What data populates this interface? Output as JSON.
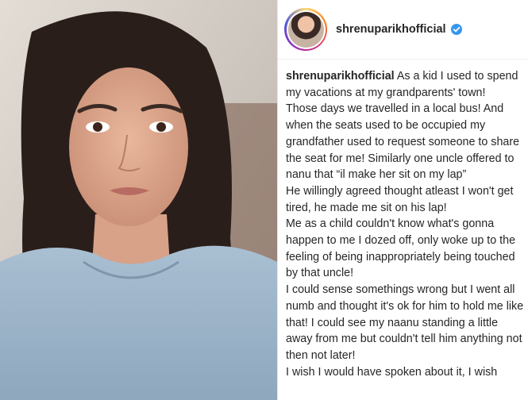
{
  "post": {
    "username": "shrenuparikhofficial",
    "verified": true,
    "caption_user": "shrenuparikhofficial",
    "caption_first": "As a kid I used to spend my vacations at my grandparents' town!",
    "caption_paragraphs": [
      "Those days we travelled in a local bus! And when the seats used to be occupied my grandfather used to request someone to share the seat for me! Similarly one uncle offered to nanu that “il make her sit on my lap”",
      "He willingly agreed thought atleast I won't get tired, he made me sit on his lap!",
      "Me as a child couldn't know what's gonna happen to me I dozed off, only woke up to the feeling of being inappropriately being touched by that uncle!",
      "I could sense somethings wrong but I went all numb and thought it's ok for him to hold me like that! I could see my naanu standing a little away from me but couldn't tell him anything not then not later!",
      "I wish I would have spoken about it, I wish"
    ]
  },
  "colors": {
    "accent_verified": "#3897f0",
    "text": "#262626"
  }
}
